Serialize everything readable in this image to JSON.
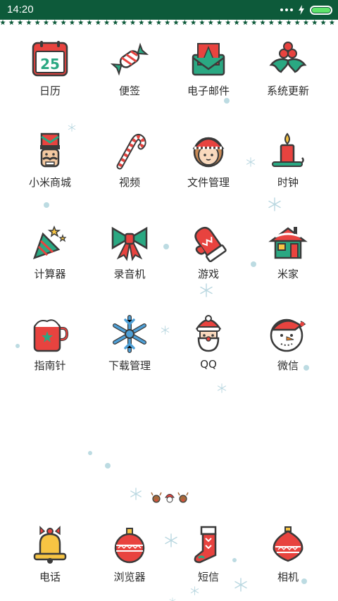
{
  "status_bar": {
    "time": "14:20"
  },
  "apps": [
    {
      "label": "日历",
      "icon": "calendar-icon",
      "calendar_day": "25"
    },
    {
      "label": "便签",
      "icon": "candy-icon"
    },
    {
      "label": "电子邮件",
      "icon": "envelope-icon"
    },
    {
      "label": "系统更新",
      "icon": "holly-berries-icon"
    },
    {
      "label": "小米商城",
      "icon": "nutcracker-icon"
    },
    {
      "label": "视频",
      "icon": "candy-cane-icon"
    },
    {
      "label": "文件管理",
      "icon": "elf-girl-icon"
    },
    {
      "label": "时钟",
      "icon": "candle-icon"
    },
    {
      "label": "计算器",
      "icon": "party-popper-icon"
    },
    {
      "label": "录音机",
      "icon": "bow-icon"
    },
    {
      "label": "游戏",
      "icon": "mitten-icon"
    },
    {
      "label": "米家",
      "icon": "house-icon"
    },
    {
      "label": "指南针",
      "icon": "mug-icon"
    },
    {
      "label": "下载管理",
      "icon": "snowflake-icon"
    },
    {
      "label": "QQ",
      "icon": "santa-icon"
    },
    {
      "label": "微信",
      "icon": "snowman-icon"
    }
  ],
  "dock": [
    {
      "label": "电话",
      "icon": "bell-icon"
    },
    {
      "label": "浏览器",
      "icon": "ornament-ball-icon"
    },
    {
      "label": "短信",
      "icon": "stocking-icon"
    },
    {
      "label": "相机",
      "icon": "ornament-drop-icon"
    }
  ],
  "colors": {
    "status_bar": "#0d5a3a",
    "red": "#e8433f",
    "green": "#2aa882",
    "outline": "#3a3a3a",
    "gold": "#f6c443"
  }
}
